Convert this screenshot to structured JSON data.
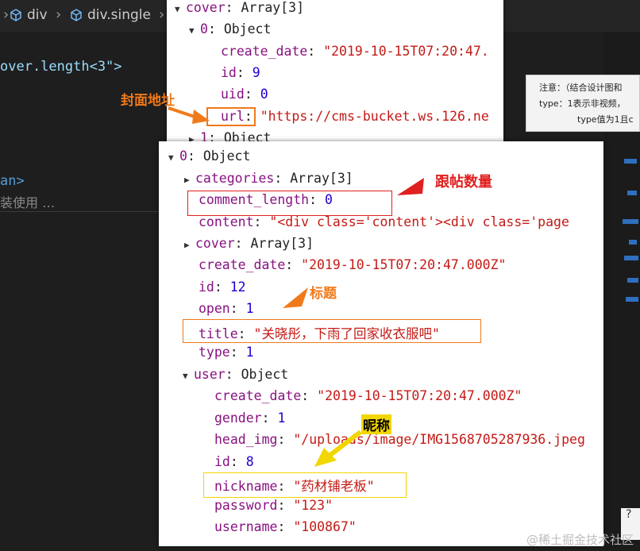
{
  "breadcrumb": {
    "items": [
      "div",
      "div.single"
    ]
  },
  "editor": {
    "line1": "over.length<3\">",
    "line2": "an>",
    "line3": "装使用 …"
  },
  "tooltip": {
    "line1": "注意：（结合设计图和",
    "line2": "type：1表示非视频，",
    "line3": "type值为1且c"
  },
  "tooltip2": "?",
  "panel_cover": {
    "rows": [
      {
        "key": "cover",
        "value": "Array[3]"
      },
      {
        "key": "0",
        "value": "Object"
      },
      {
        "key": "create_date",
        "value": "\"2019-10-15T07:20:47."
      },
      {
        "key": "id",
        "value": "9"
      },
      {
        "key": "uid",
        "value": "0"
      },
      {
        "key": "url",
        "value": "\"https://cms-bucket.ws.126.ne"
      },
      {
        "key": "1",
        "value": "Object"
      }
    ]
  },
  "panel_item": {
    "rows": [
      {
        "key": "0",
        "value": "Object"
      },
      {
        "key": "categories",
        "value": "Array[3]"
      },
      {
        "key": "comment_length",
        "value": "0"
      },
      {
        "key": "content",
        "value": "\"<div class='content'><div class='page"
      },
      {
        "key": "cover",
        "value": "Array[3]"
      },
      {
        "key": "create_date",
        "value": "\"2019-10-15T07:20:47.000Z\""
      },
      {
        "key": "id",
        "value": "12"
      },
      {
        "key": "open",
        "value": "1"
      },
      {
        "key": "title",
        "value": "\"关晓彤，下雨了回家收衣服吧\""
      },
      {
        "key": "type",
        "value": "1"
      },
      {
        "key": "user",
        "value": "Object"
      },
      {
        "key": "create_date",
        "value": "\"2019-10-15T07:20:47.000Z\""
      },
      {
        "key": "gender",
        "value": "1"
      },
      {
        "key": "head_img",
        "value": "\"/uploads/image/IMG1568705287936.jpeg"
      },
      {
        "key": "id",
        "value": "8"
      },
      {
        "key": "nickname",
        "value": "\"药材铺老板\""
      },
      {
        "key": "password",
        "value": "\"123\""
      },
      {
        "key": "username",
        "value": "\"100867\""
      }
    ]
  },
  "annotations": {
    "cover_url": "封面地址",
    "comment_count": "跟帖数量",
    "title": "标题",
    "nickname": "昵称"
  },
  "colors": {
    "orange": "#f07a1a",
    "red": "#e02020",
    "yellow": "#f2d600"
  },
  "watermark": "@稀土掘金技术社区"
}
